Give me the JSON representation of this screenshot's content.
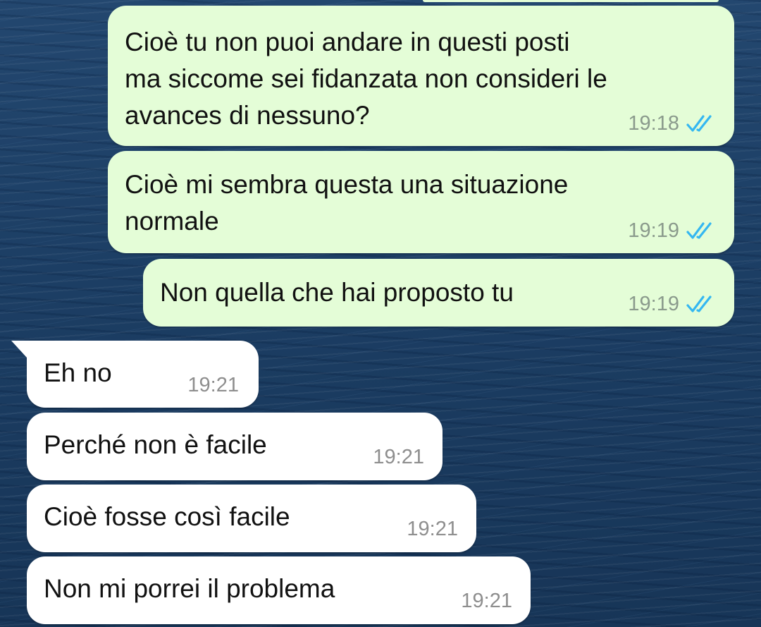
{
  "chat": {
    "messages": [
      {
        "direction": "outgoing",
        "lines": [
          "Cioè tu non puoi andare in questi posti",
          "ma siccome sei fidanzata non consideri le",
          "avances di nessuno?"
        ],
        "time": "19:18",
        "status": "double-check-read-icon"
      },
      {
        "direction": "outgoing",
        "lines": [
          "Cioè mi sembra questa una situazione",
          "normale"
        ],
        "time": "19:19",
        "status": "double-check-read-icon"
      },
      {
        "direction": "outgoing",
        "lines": [
          "Non quella che hai proposto tu"
        ],
        "time": "19:19",
        "status": "double-check-read-icon"
      },
      {
        "direction": "incoming",
        "lines": [
          "Eh no"
        ],
        "time": "19:21"
      },
      {
        "direction": "incoming",
        "lines": [
          "Perché non è facile"
        ],
        "time": "19:21"
      },
      {
        "direction": "incoming",
        "lines": [
          "Cioè fosse così facile"
        ],
        "time": "19:21"
      },
      {
        "direction": "incoming",
        "lines": [
          "Non mi porrei il problema"
        ],
        "time": "19:21"
      }
    ]
  },
  "colors": {
    "outgoing_bubble": "#e4fdd7",
    "incoming_bubble": "#ffffff",
    "read_ticks": "#34b7f1",
    "wallpaper": "#1d3f66"
  }
}
